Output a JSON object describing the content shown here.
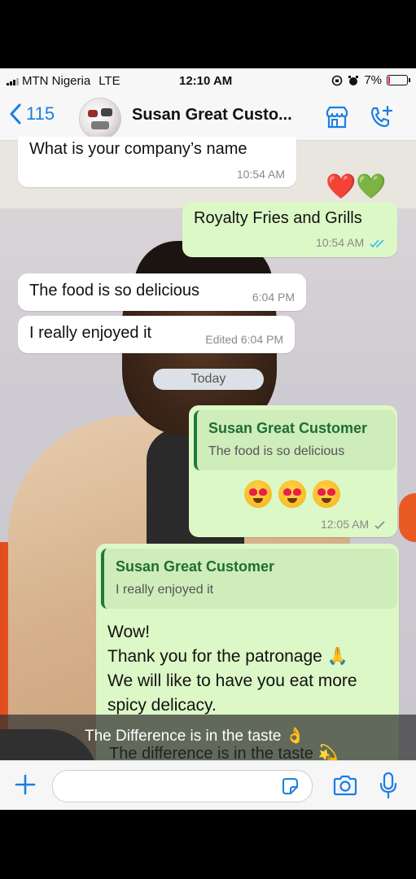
{
  "status_bar": {
    "carrier": "MTN Nigeria",
    "network": "LTE",
    "time": "12:10 AM",
    "battery": "7%",
    "battery_level": 0.07
  },
  "header": {
    "back_count": "115",
    "contact_name": "Susan Great Custo...",
    "icons": [
      "chevron-left-icon",
      "store-icon",
      "add-call-icon"
    ]
  },
  "messages": [
    {
      "direction": "incoming",
      "text": "What is your company’s name",
      "time": "10:54 AM"
    },
    {
      "direction": "outgoing",
      "text": "Royalty Fries and Grills",
      "time": "10:54 AM",
      "status": "read"
    },
    {
      "direction": "incoming",
      "text": "The food is so delicious",
      "time": "6:04 PM"
    },
    {
      "direction": "incoming",
      "text": "I really enjoyed it",
      "time": "Edited 6:04 PM"
    },
    {
      "direction": "outgoing",
      "reply_to": {
        "name": "Susan Great Customer",
        "text": "The food is so delicious"
      },
      "emoji": "😍😍😍",
      "time": "12:05 AM",
      "status": "sent"
    },
    {
      "direction": "outgoing",
      "reply_to": {
        "name": "Susan Great Customer",
        "text": "I really enjoyed it"
      },
      "lines": [
        "Wow!",
        "Thank you for the patronage 🙏",
        "We will like to have you eat more",
        "spicy delicacy."
      ]
    }
  ],
  "reactions": "❤️💚💙",
  "day_separator": "Today",
  "caption": {
    "overlay": "The Difference is in the taste 👌",
    "underlying": "The difference is in the taste 💫"
  },
  "input_bar": {
    "placeholder": "",
    "icons": [
      "plus-icon",
      "sticker-icon",
      "camera-icon",
      "microphone-icon"
    ]
  },
  "colors": {
    "accent": "#1a7ee6",
    "outgoing_bubble": "#dcf8c6",
    "incoming_bubble": "#ffffff",
    "quote_name": "#1e6e34",
    "read_ticks": "#34b7f1"
  }
}
